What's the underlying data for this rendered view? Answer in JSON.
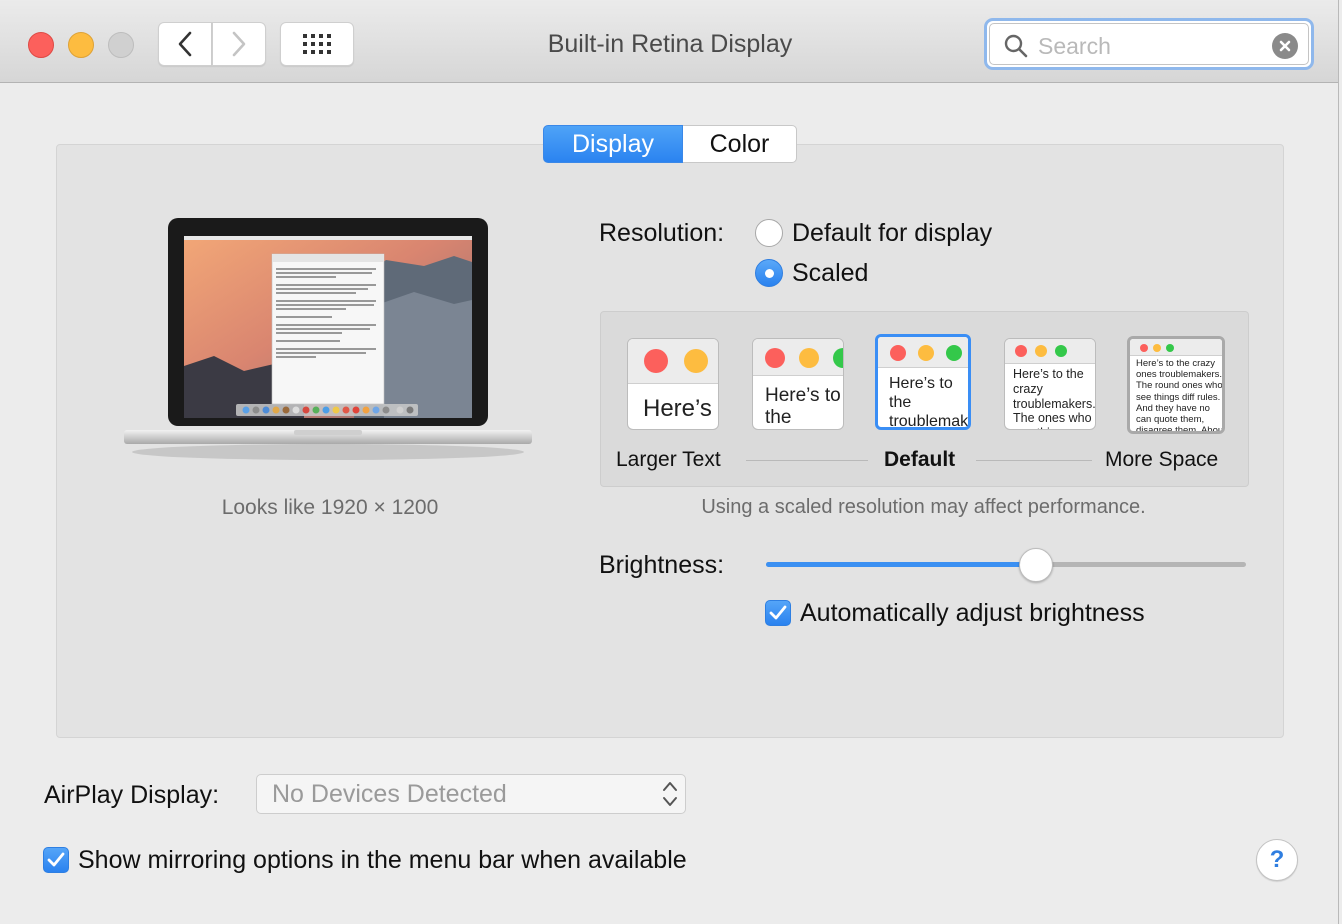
{
  "window": {
    "title": "Built-in Retina Display",
    "search_placeholder": "Search"
  },
  "tabs": [
    {
      "label": "Display",
      "active": true
    },
    {
      "label": "Color",
      "active": false
    }
  ],
  "display": {
    "looks_like": "Looks like 1920 × 1200",
    "resolution_label": "Resolution:",
    "resolution_options": [
      {
        "label": "Default for display",
        "selected": false
      },
      {
        "label": "Scaled",
        "selected": true
      }
    ],
    "scale_options": [
      {
        "preview_text": "Here’s",
        "selected": false
      },
      {
        "preview_text": "Here’s to the troublemakers.",
        "selected": false
      },
      {
        "preview_text": "Here’s to the troublemakers ones who see",
        "selected": true
      },
      {
        "preview_text": "Here’s to the crazy troublemakers. The ones who see things rules. And they",
        "selected": false
      },
      {
        "preview_text": "Here’s to the crazy ones troublemakers. The round ones who see things diff rules. And they have no can quote them, disagree them. About the only thing Because they change th",
        "selected": false
      }
    ],
    "scale_labels": {
      "left": "Larger Text",
      "middle": "Default",
      "right": "More Space"
    },
    "performance_note": "Using a scaled resolution may affect performance.",
    "brightness_label": "Brightness:",
    "brightness_level": 0.56,
    "auto_brightness_label": "Automatically adjust brightness",
    "auto_brightness_checked": true
  },
  "airplay": {
    "label": "AirPlay Display:",
    "value": "No Devices Detected"
  },
  "mirroring": {
    "label": "Show mirroring options in the menu bar when available",
    "checked": true
  },
  "colors": {
    "accent": "#2b83f0",
    "close": "#fc605c",
    "minimize": "#fdbc40",
    "zoom": "#34c84a"
  }
}
